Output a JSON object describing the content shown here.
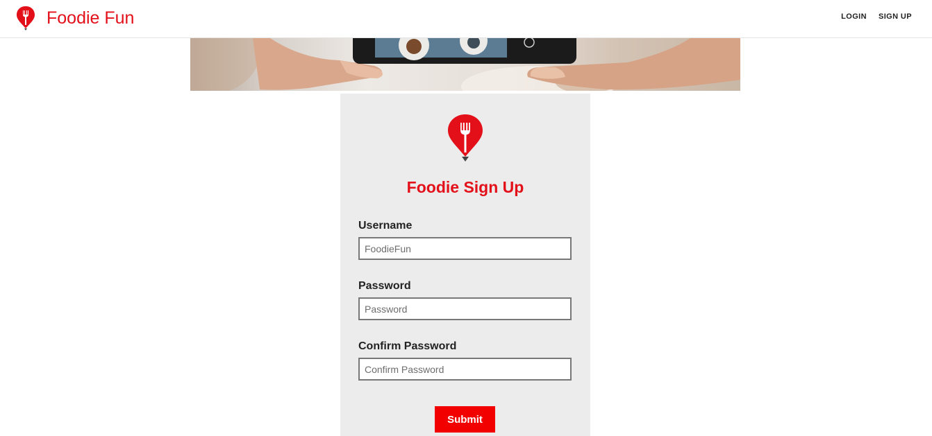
{
  "header": {
    "brand_name": "Foodie Fun",
    "brand_icon": "fork-pin-icon",
    "nav": [
      {
        "label": "LOGIN"
      },
      {
        "label": "SIGN UP"
      }
    ]
  },
  "hero": {
    "description_icon": "phone-photo-of-food-image"
  },
  "form": {
    "logo_icon": "fork-pin-icon",
    "title": "Foodie Sign Up",
    "fields": [
      {
        "label": "Username",
        "value": "",
        "placeholder": "FoodieFun"
      },
      {
        "label": "Password",
        "value": "",
        "placeholder": "Password"
      },
      {
        "label": "Confirm Password",
        "value": "",
        "placeholder": "Confirm Password"
      }
    ],
    "submit_label": "Submit"
  },
  "colors": {
    "brand_red": "#e3101a",
    "button_red": "#f20000",
    "card_bg": "#ececec"
  }
}
